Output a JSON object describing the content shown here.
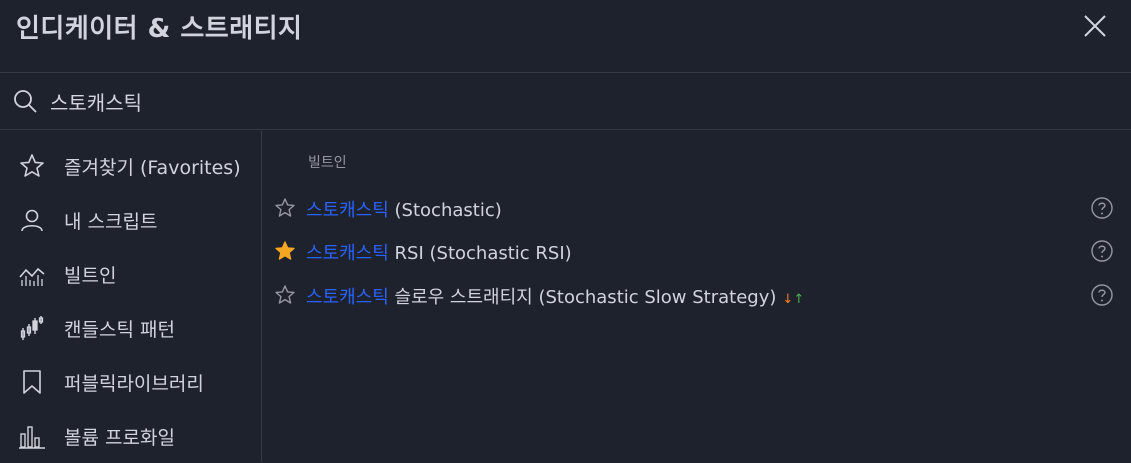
{
  "header": {
    "title": "인디케이터 & 스트래티지"
  },
  "search": {
    "value": "스토캐스틱"
  },
  "sidebar": {
    "items": [
      {
        "label": "즐겨찾기 (Favorites)",
        "icon": "star-icon"
      },
      {
        "label": "내 스크립트",
        "icon": "user-icon"
      },
      {
        "label": "빌트인",
        "icon": "chart-icon"
      },
      {
        "label": "캔들스틱 패턴",
        "icon": "candlestick-icon"
      },
      {
        "label": "퍼블릭라이브러리",
        "icon": "bookmark-icon"
      },
      {
        "label": "볼륨 프로화일",
        "icon": "volume-bars-icon"
      }
    ]
  },
  "main": {
    "section_label": "빌트인",
    "results": [
      {
        "highlight": "스토캐스틱",
        "rest": " (Stochastic)",
        "favorite": false
      },
      {
        "highlight": "스토캐스틱",
        "rest": " RSI (Stochastic RSI)",
        "favorite": true
      },
      {
        "highlight": "스토캐스틱",
        "rest": " 슬로우 스트래티지 (Stochastic Slow Strategy)",
        "favorite": false,
        "arrow_down": "↓",
        "arrow_up": "↑"
      }
    ]
  },
  "colors": {
    "background": "#1e222d",
    "border": "#363a45",
    "text": "#d1d4dc",
    "highlight": "#2962ff",
    "favorite_star": "#f5a623"
  }
}
